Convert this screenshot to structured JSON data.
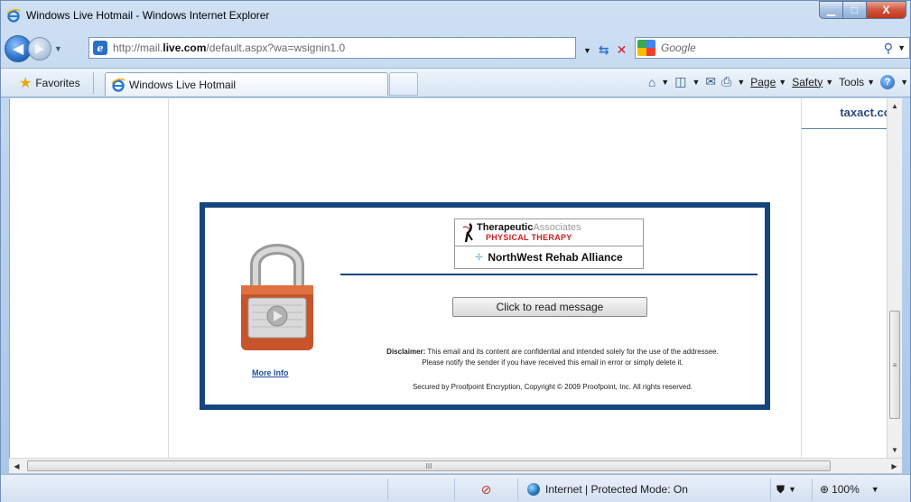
{
  "window": {
    "title": "Windows Live Hotmail - Windows Internet Explorer",
    "controls": {
      "minimize": "▁",
      "maximize": "□",
      "close": "X"
    }
  },
  "nav": {
    "back_label": "◀",
    "forward_label": "▶",
    "address": {
      "prefix": "http://mail.",
      "domain": "live.com",
      "suffix": "/default.aspx?wa=wsignin1.0"
    },
    "search_placeholder": "Google"
  },
  "favorites_bar": {
    "favorites_label": "Favorites",
    "tab_title": "Windows Live Hotmail"
  },
  "command_bar": {
    "page": "Page",
    "safety": "Safety",
    "tools": "Tools"
  },
  "page": {
    "right_ad_text": "taxact.cc",
    "logo_line1_bold": "Therapeutic",
    "logo_line1_light": "Associates",
    "logo_line2": "PHYSICAL THERAPY",
    "logo_line3": "NorthWest Rehab Alliance",
    "read_button": "Click to read message",
    "more_info": "More Info",
    "disclaimer_label": "Disclaimer:",
    "disclaimer_text": " This email and its content are confidential and intended solely for the use of the addressee.",
    "disclaimer_line2": "Please notify the sender if you have received this email in error or simply delete it.",
    "secured_text": "Secured by Proofpoint Encryption, Copyright © 2009 Proofpoint, Inc. All rights reserved."
  },
  "hscroll_grip": "III",
  "vscroll_grip": "≡",
  "status": {
    "zone": "Internet | Protected Mode: On",
    "zoom": "100%"
  },
  "colors": {
    "frame_border": "#15457f",
    "link": "#1f4fa0",
    "logo_red": "#d11d1d"
  }
}
